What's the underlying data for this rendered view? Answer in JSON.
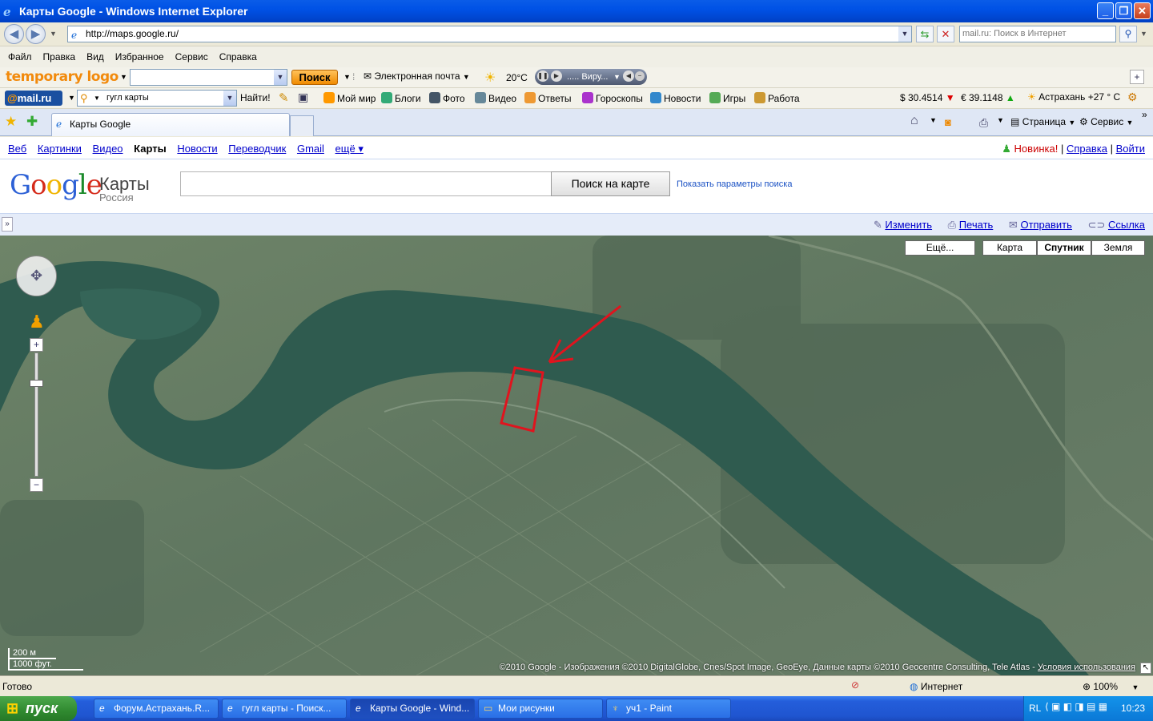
{
  "window": {
    "title": "Карты Google - Windows Internet Explorer",
    "minimize": "_",
    "maximize": "❐",
    "close": "✕"
  },
  "address": {
    "url": "http://maps.google.ru/",
    "search_placeholder": "mail.ru: Поиск в Интернет"
  },
  "menu": [
    "Файл",
    "Правка",
    "Вид",
    "Избранное",
    "Сервис",
    "Справка"
  ],
  "toolbar1": {
    "logo": "temporary logo",
    "search_btn": "Поиск",
    "email": "Электронная почта",
    "weather": "20°C",
    "player": "..... Виру..."
  },
  "toolbar2": {
    "mailru": "mail.ru",
    "query": "гугл карты",
    "find": "Найти!",
    "links": [
      "Мой мир",
      "Блоги",
      "Фото",
      "Видео",
      "Ответы",
      "Гороскопы",
      "Новости",
      "Игры",
      "Работа"
    ],
    "usd": "$ 30.4514",
    "eur": "€ 39.1148",
    "city_weather": "Астрахань +27 ° С"
  },
  "tabs": {
    "active": "Карты Google",
    "cmd_page": "Страница",
    "cmd_service": "Сервис"
  },
  "google_bar": {
    "left": [
      "Веб",
      "Картинки",
      "Видео",
      "Карты",
      "Новости",
      "Переводчик",
      "Gmail",
      "ещё ▾"
    ],
    "new": "Новинка!",
    "help": "Справка",
    "login": "Войти",
    "sep": "|"
  },
  "maps": {
    "brand": "Карты",
    "country": "Россия",
    "search_btn": "Поиск на карте",
    "params": "Показать параметры поиска",
    "search_value": ""
  },
  "actions": {
    "expand": "»",
    "items": [
      "Изменить",
      "Печать",
      "Отправить",
      "Ссылка"
    ]
  },
  "map": {
    "types": [
      "Ещё...",
      "Карта",
      "Спутник",
      "Земля"
    ],
    "active_type": "Спутник",
    "scale_m": "200 м",
    "scale_ft": "1000 фут.",
    "copyright": "©2010 Google - Изображения ©2010 DigitalGlobe, Cnes/Spot Image, GeoEye, Данные карты ©2010 Geocentre Consulting, Tele Atlas - ",
    "terms": "Условия использования"
  },
  "status": {
    "ready": "Готово",
    "zone": "Интернет",
    "zoom": "100%"
  },
  "taskbar": {
    "start": "пуск",
    "tasks": [
      "Форум.Астрахань.R...",
      "гугл карты - Поиск...",
      "Карты Google - Wind...",
      "Мои рисунки",
      "уч1 - Paint"
    ],
    "active_task": 2,
    "lang": "RL",
    "clock": "10:23"
  },
  "colors": {
    "accent_red": "#e0141e",
    "link": "#0000cc",
    "river": "#2f5b4f"
  }
}
